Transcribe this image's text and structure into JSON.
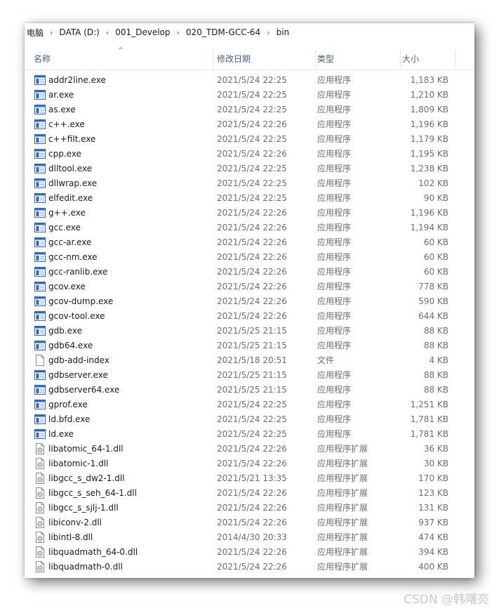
{
  "breadcrumb": [
    "电脑",
    "DATA (D:)",
    "001_Develop",
    "020_TDM-GCC-64",
    "bin"
  ],
  "breadcrumb_separator": "›",
  "columns": {
    "name": "名称",
    "date": "修改日期",
    "type": "类型",
    "size": "大小"
  },
  "sort_indicator": "^",
  "files": [
    {
      "name": "addr2line.exe",
      "date": "2021/5/24 22:25",
      "type": "应用程序",
      "size": "1,183 KB",
      "icon": "exe-icon"
    },
    {
      "name": "ar.exe",
      "date": "2021/5/24 22:25",
      "type": "应用程序",
      "size": "1,210 KB",
      "icon": "exe-icon"
    },
    {
      "name": "as.exe",
      "date": "2021/5/24 22:25",
      "type": "应用程序",
      "size": "1,809 KB",
      "icon": "exe-icon"
    },
    {
      "name": "c++.exe",
      "date": "2021/5/24 22:26",
      "type": "应用程序",
      "size": "1,196 KB",
      "icon": "exe-icon"
    },
    {
      "name": "c++filt.exe",
      "date": "2021/5/24 22:25",
      "type": "应用程序",
      "size": "1,179 KB",
      "icon": "exe-icon"
    },
    {
      "name": "cpp.exe",
      "date": "2021/5/24 22:26",
      "type": "应用程序",
      "size": "1,195 KB",
      "icon": "exe-icon"
    },
    {
      "name": "dlltool.exe",
      "date": "2021/5/24 22:25",
      "type": "应用程序",
      "size": "1,238 KB",
      "icon": "exe-icon"
    },
    {
      "name": "dllwrap.exe",
      "date": "2021/5/24 22:25",
      "type": "应用程序",
      "size": "102 KB",
      "icon": "exe-icon"
    },
    {
      "name": "elfedit.exe",
      "date": "2021/5/24 22:25",
      "type": "应用程序",
      "size": "90 KB",
      "icon": "exe-icon"
    },
    {
      "name": "g++.exe",
      "date": "2021/5/24 22:26",
      "type": "应用程序",
      "size": "1,196 KB",
      "icon": "exe-icon"
    },
    {
      "name": "gcc.exe",
      "date": "2021/5/24 22:26",
      "type": "应用程序",
      "size": "1,194 KB",
      "icon": "exe-icon"
    },
    {
      "name": "gcc-ar.exe",
      "date": "2021/5/24 22:26",
      "type": "应用程序",
      "size": "60 KB",
      "icon": "exe-icon"
    },
    {
      "name": "gcc-nm.exe",
      "date": "2021/5/24 22:26",
      "type": "应用程序",
      "size": "60 KB",
      "icon": "exe-icon"
    },
    {
      "name": "gcc-ranlib.exe",
      "date": "2021/5/24 22:26",
      "type": "应用程序",
      "size": "60 KB",
      "icon": "exe-icon"
    },
    {
      "name": "gcov.exe",
      "date": "2021/5/24 22:26",
      "type": "应用程序",
      "size": "778 KB",
      "icon": "exe-icon"
    },
    {
      "name": "gcov-dump.exe",
      "date": "2021/5/24 22:26",
      "type": "应用程序",
      "size": "590 KB",
      "icon": "exe-icon"
    },
    {
      "name": "gcov-tool.exe",
      "date": "2021/5/24 22:26",
      "type": "应用程序",
      "size": "644 KB",
      "icon": "exe-icon"
    },
    {
      "name": "gdb.exe",
      "date": "2021/5/25 21:15",
      "type": "应用程序",
      "size": "88 KB",
      "icon": "exe-icon"
    },
    {
      "name": "gdb64.exe",
      "date": "2021/5/25 21:15",
      "type": "应用程序",
      "size": "88 KB",
      "icon": "exe-icon"
    },
    {
      "name": "gdb-add-index",
      "date": "2021/5/18 20:51",
      "type": "文件",
      "size": "4 KB",
      "icon": "file-icon"
    },
    {
      "name": "gdbserver.exe",
      "date": "2021/5/25 21:15",
      "type": "应用程序",
      "size": "88 KB",
      "icon": "exe-icon"
    },
    {
      "name": "gdbserver64.exe",
      "date": "2021/5/25 21:15",
      "type": "应用程序",
      "size": "88 KB",
      "icon": "exe-icon"
    },
    {
      "name": "gprof.exe",
      "date": "2021/5/24 22:25",
      "type": "应用程序",
      "size": "1,251 KB",
      "icon": "exe-icon"
    },
    {
      "name": "ld.bfd.exe",
      "date": "2021/5/24 22:25",
      "type": "应用程序",
      "size": "1,781 KB",
      "icon": "exe-icon"
    },
    {
      "name": "ld.exe",
      "date": "2021/5/24 22:25",
      "type": "应用程序",
      "size": "1,781 KB",
      "icon": "exe-icon"
    },
    {
      "name": "libatomic_64-1.dll",
      "date": "2021/5/24 22:26",
      "type": "应用程序扩展",
      "size": "36 KB",
      "icon": "dll-icon"
    },
    {
      "name": "libatomic-1.dll",
      "date": "2021/5/24 22:26",
      "type": "应用程序扩展",
      "size": "30 KB",
      "icon": "dll-icon"
    },
    {
      "name": "libgcc_s_dw2-1.dll",
      "date": "2021/5/21 13:35",
      "type": "应用程序扩展",
      "size": "170 KB",
      "icon": "dll-icon"
    },
    {
      "name": "libgcc_s_seh_64-1.dll",
      "date": "2021/5/24 22:26",
      "type": "应用程序扩展",
      "size": "123 KB",
      "icon": "dll-icon"
    },
    {
      "name": "libgcc_s_sjlj-1.dll",
      "date": "2021/5/24 22:26",
      "type": "应用程序扩展",
      "size": "131 KB",
      "icon": "dll-icon"
    },
    {
      "name": "libiconv-2.dll",
      "date": "2021/5/24 22:26",
      "type": "应用程序扩展",
      "size": "937 KB",
      "icon": "dll-icon"
    },
    {
      "name": "libintl-8.dll",
      "date": "2014/4/30 20:33",
      "type": "应用程序扩展",
      "size": "474 KB",
      "icon": "dll-icon"
    },
    {
      "name": "libquadmath_64-0.dll",
      "date": "2021/5/24 22:26",
      "type": "应用程序扩展",
      "size": "394 KB",
      "icon": "dll-icon"
    },
    {
      "name": "libquadmath-0.dll",
      "date": "2021/5/24 22:26",
      "type": "应用程序扩展",
      "size": "400 KB",
      "icon": "dll-icon"
    }
  ],
  "watermark": "CSDN @韩曙亮",
  "colors": {
    "header_text": "#4c607a",
    "secondary_text": "#6d6d6d",
    "exe_icon_blue": "#2b6cc4"
  }
}
